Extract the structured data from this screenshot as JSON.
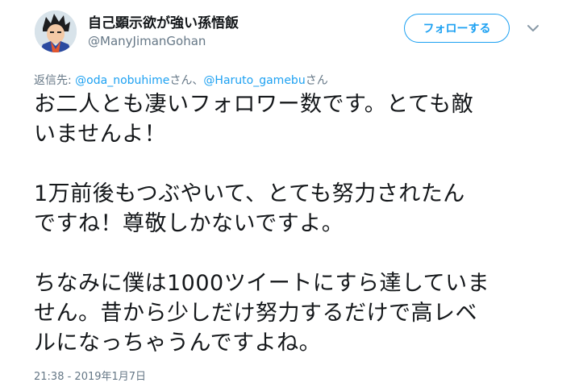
{
  "author": {
    "display_name": "自己顕示欲が強い孫悟飯",
    "screen_name": "@ManyJimanGohan"
  },
  "follow_button": {
    "label": "フォローする"
  },
  "menu": {
    "icon": "chevron-down-icon"
  },
  "reply": {
    "prefix": "返信先: ",
    "mention_1": "@oda_nobuhime",
    "suffix_1": "さん、",
    "mention_2": "@Haruto_gamebu",
    "suffix_2": "さん"
  },
  "tweet": {
    "lines": [
      "お二人とも凄いフォロワー数です。とても敵",
      "いませんよ！",
      "",
      "1万前後もつぶやいて、とても努力されたん",
      "ですね！尊敬しかないですよ。",
      "",
      "ちなみに僕は1000ツイートにすら達していま",
      "せん。昔から少しだけ努力するだけで高レベ",
      "ルになっちゃうんですよね。"
    ]
  },
  "timestamp": "21:38 - 2019年1月7日",
  "colors": {
    "accent": "#1da1f2",
    "text": "#14171a",
    "muted": "#657786"
  }
}
